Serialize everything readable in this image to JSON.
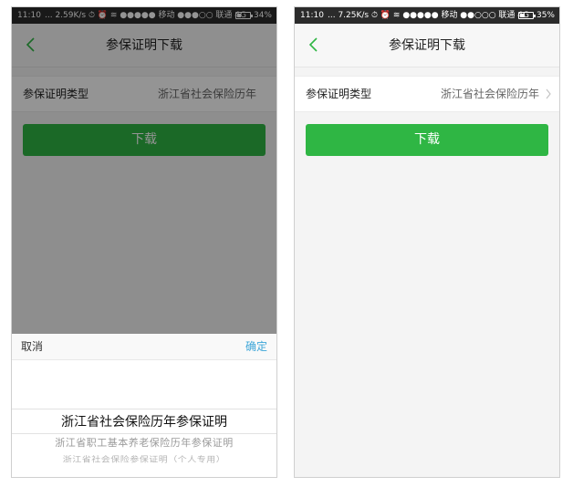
{
  "screens": [
    {
      "status": {
        "time": "11:10",
        "middle": "... 2.59K/s ⏱ ⏰ ≋ ●●●●● 移动 ●●●○○ 联通 4G",
        "battery_percent": "34%",
        "battery_level": 0.34
      },
      "nav": {
        "title": "参保证明下载",
        "back_icon": "chevron-left-icon"
      },
      "row": {
        "label": "参保证明类型",
        "value": "浙江省社会保险历年"
      },
      "button": {
        "label": "下载"
      },
      "sheet": {
        "cancel": "取消",
        "confirm": "确定",
        "options": [
          "浙江省社会保险历年参保证明",
          "浙江省职工基本养老保险历年参保证明",
          "浙江省社会保险参保证明（个人专用）"
        ],
        "selected_index": 0
      }
    },
    {
      "status": {
        "time": "11:10",
        "middle": "... 7.25K/s ⏱ ⏰ ≋ ●●●●● 移动 ●●○○○ 联通 4G",
        "battery_percent": "35%",
        "battery_level": 0.35
      },
      "nav": {
        "title": "参保证明下载",
        "back_icon": "chevron-left-icon"
      },
      "row": {
        "label": "参保证明类型",
        "value": "浙江省社会保险历年",
        "chevron_icon": "chevron-right-icon"
      },
      "button": {
        "label": "下载"
      }
    }
  ],
  "colors": {
    "accent_green": "#2fb644",
    "confirm_blue": "#3da6d8",
    "statusbar": "#2b2b2b"
  }
}
